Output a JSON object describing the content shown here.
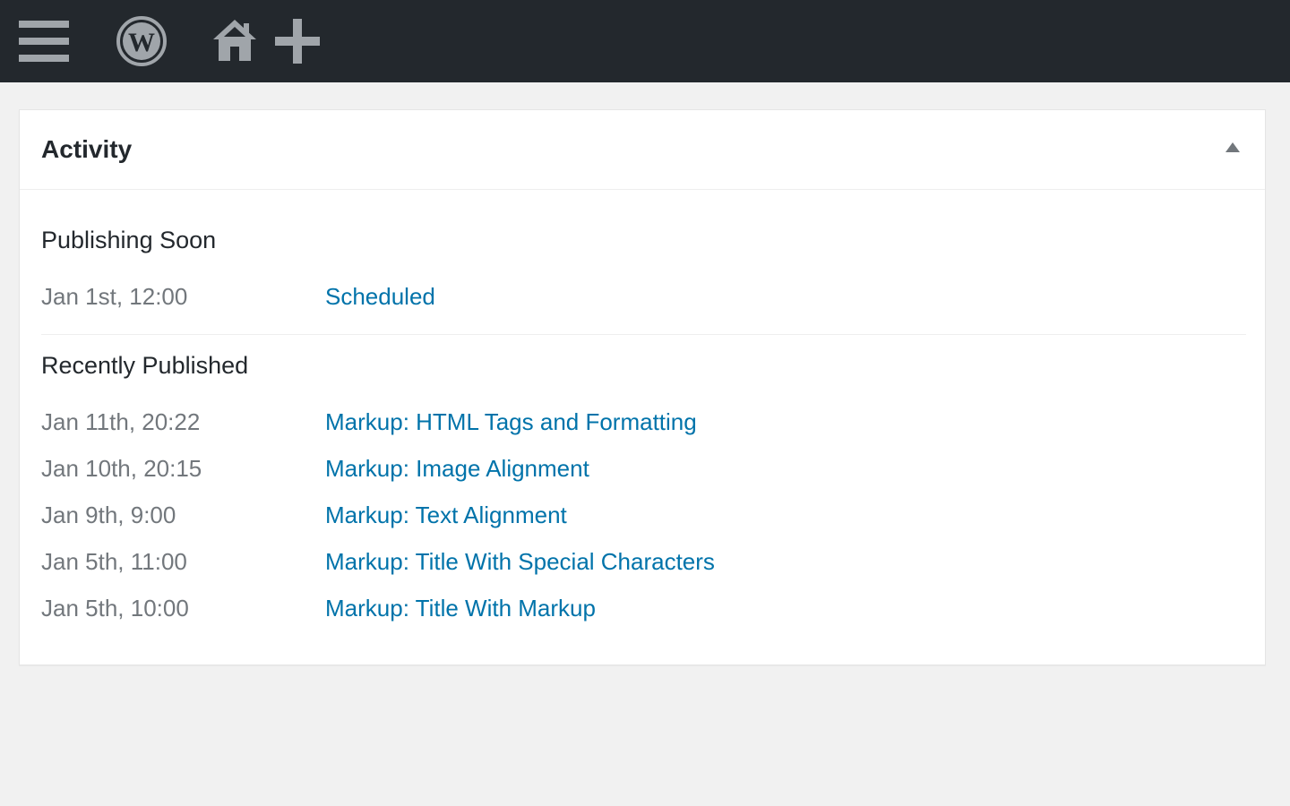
{
  "topbar": {
    "icons": [
      "menu-icon",
      "wordpress-icon",
      "home-icon",
      "plus-icon"
    ],
    "background": "#23282d",
    "icon_color": "#a0a5aa"
  },
  "activity": {
    "title": "Activity",
    "publishing_soon": {
      "heading": "Publishing Soon",
      "items": [
        {
          "date": "Jan 1st, 12:00",
          "title": "Scheduled"
        }
      ]
    },
    "recently_published": {
      "heading": "Recently Published",
      "items": [
        {
          "date": "Jan 11th, 20:22",
          "title": "Markup: HTML Tags and Formatting"
        },
        {
          "date": "Jan 10th, 20:15",
          "title": "Markup: Image Alignment"
        },
        {
          "date": "Jan 9th, 9:00",
          "title": "Markup: Text Alignment"
        },
        {
          "date": "Jan 5th, 11:00",
          "title": "Markup: Title With Special Characters"
        },
        {
          "date": "Jan 5th, 10:00",
          "title": "Markup: Title With Markup"
        }
      ]
    }
  },
  "colors": {
    "link": "#0073aa",
    "muted": "#72777c",
    "text": "#23282d",
    "page_bg": "#f1f1f1"
  }
}
